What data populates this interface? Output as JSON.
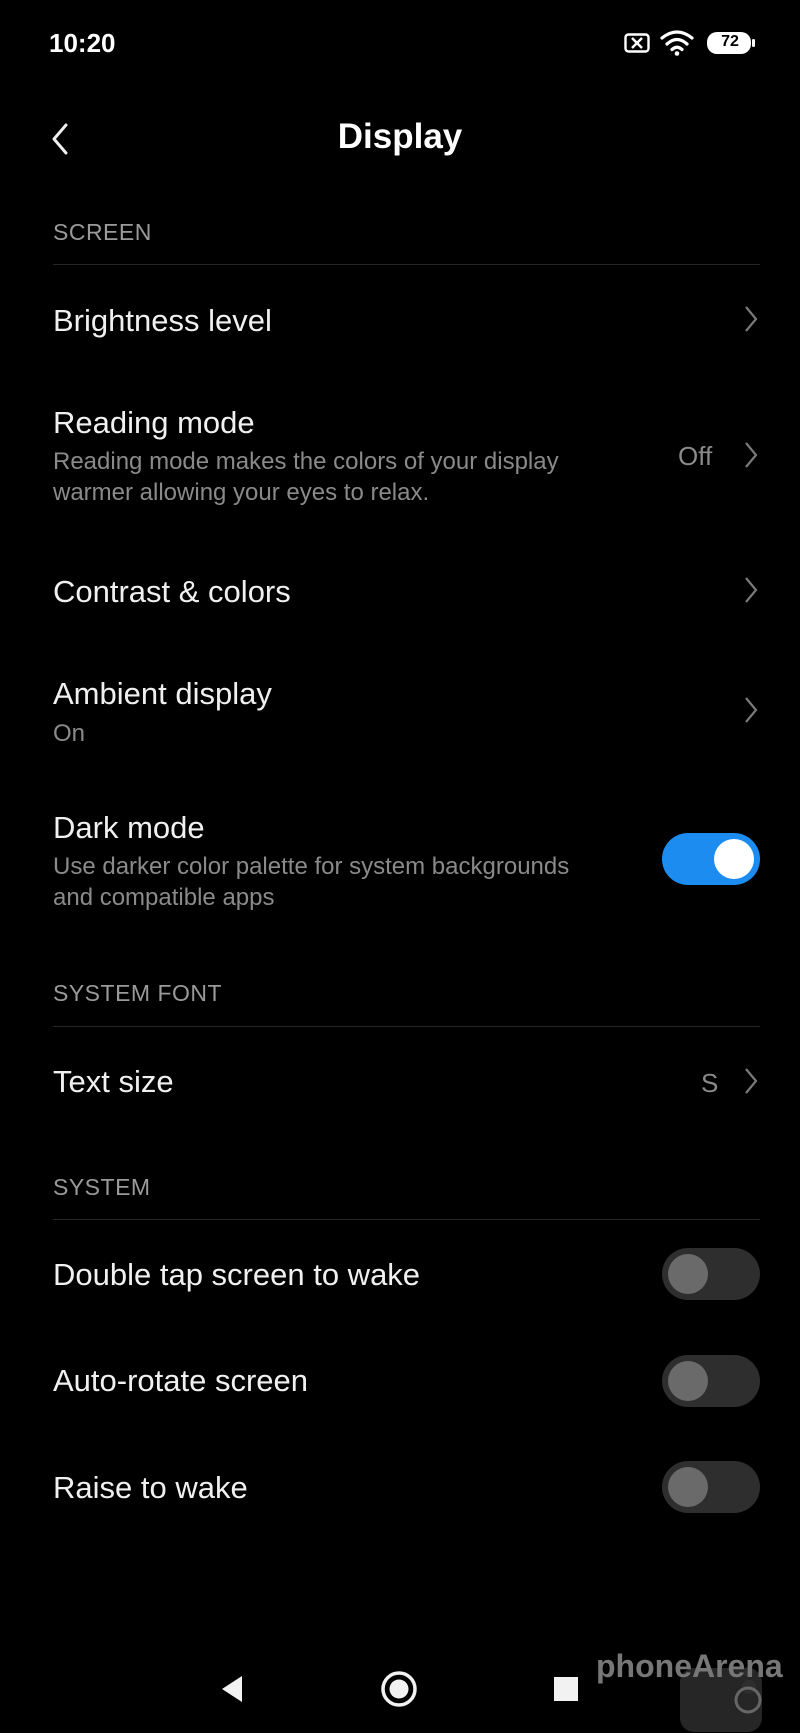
{
  "status_bar": {
    "time": "10:20",
    "battery": "72",
    "icons": [
      "sim-blocked-icon",
      "wifi-icon",
      "battery-icon"
    ]
  },
  "header": {
    "title": "Display",
    "back_icon": "chevron-left-icon"
  },
  "sections": {
    "screen": "SCREEN",
    "system_font": "SYSTEM FONT",
    "system": "SYSTEM"
  },
  "rows": {
    "brightness": {
      "title": "Brightness level"
    },
    "reading": {
      "title": "Reading mode",
      "sub_line1": "Reading mode makes the colors of your display",
      "sub_line2": "warmer allowing your eyes to relax.",
      "value": "Off"
    },
    "contrast": {
      "title": "Contrast & colors"
    },
    "ambient": {
      "title": "Ambient display",
      "value": "On"
    },
    "dark": {
      "title": "Dark mode",
      "sub_line1": "Use darker color palette for system backgrounds",
      "sub_line2": "and compatible apps",
      "enabled": true
    },
    "text_size": {
      "title": "Text size",
      "value": "S"
    },
    "double_tap": {
      "title": "Double tap screen to wake",
      "enabled": false
    },
    "auto_rotate": {
      "title": "Auto-rotate screen",
      "enabled": false
    },
    "raise_wake": {
      "title": "Raise to wake",
      "enabled": false
    }
  },
  "nav_bar": {
    "icons": [
      "nav-back-icon",
      "nav-home-icon",
      "nav-recents-icon"
    ]
  },
  "watermark": {
    "text": "phoneArena"
  },
  "colors": {
    "background": "#000000",
    "accent": "#1d8cf0",
    "secondary_text": "#8a8a8a"
  }
}
